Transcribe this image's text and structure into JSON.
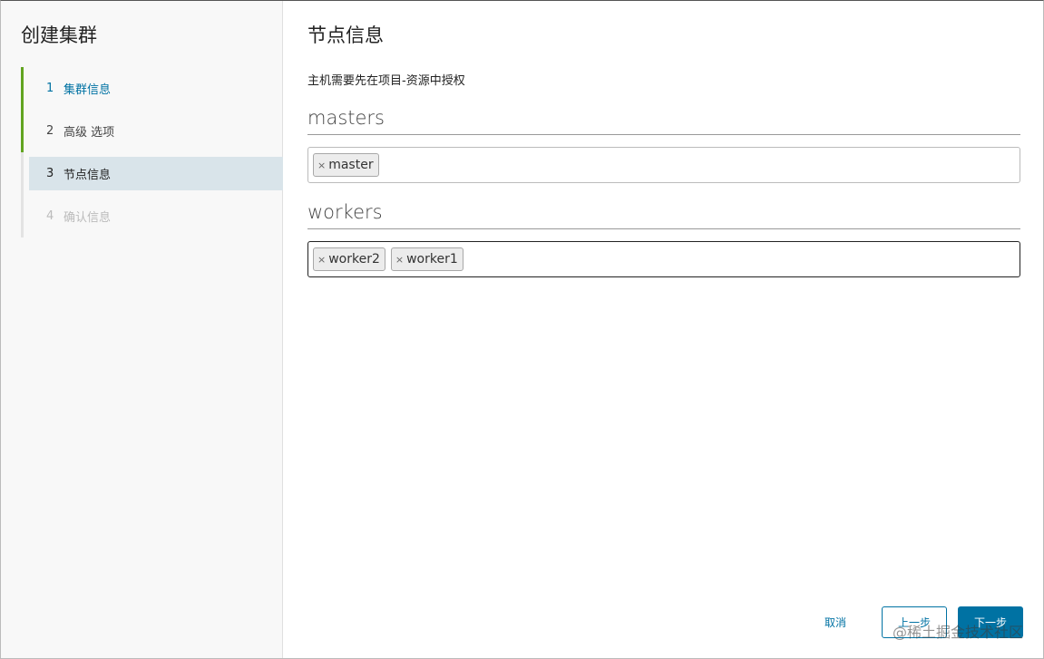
{
  "sidebar": {
    "title": "创建集群",
    "steps": [
      {
        "num": "1",
        "label": "集群信息"
      },
      {
        "num": "2",
        "label": "高级 选项"
      },
      {
        "num": "3",
        "label": "节点信息"
      },
      {
        "num": "4",
        "label": "确认信息"
      }
    ]
  },
  "main": {
    "title": "节点信息",
    "hint": "主机需要先在项目-资源中授权",
    "masters": {
      "label": "masters",
      "tags": [
        "master"
      ]
    },
    "workers": {
      "label": "workers",
      "tags": [
        "worker2",
        "worker1"
      ]
    },
    "tag_remove_icon": "×"
  },
  "footer": {
    "cancel": "取消",
    "prev": "上一步",
    "next": "下一步"
  },
  "watermark": "@稀土掘金技术社区",
  "colors": {
    "accent": "#0072a3",
    "step_done": "#62a420",
    "current_step_bg": "#d9e4ea"
  }
}
